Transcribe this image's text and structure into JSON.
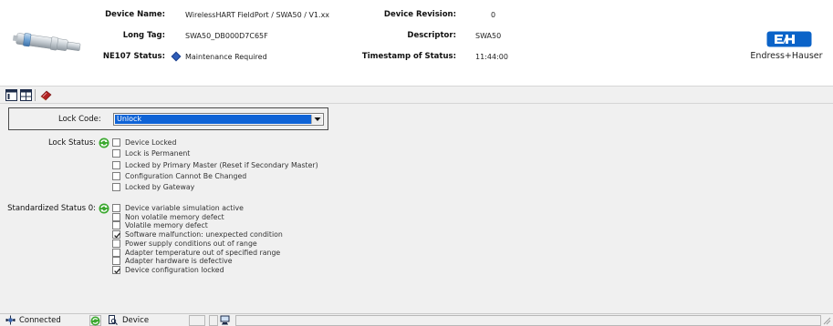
{
  "header": {
    "device_name_label": "Device Name:",
    "device_name_value": "WirelessHART FieldPort / SWA50 / V1.xx",
    "long_tag_label": "Long Tag:",
    "long_tag_value": "SWA50_DB000D7C65F",
    "ne107_label": "NE107 Status:",
    "ne107_value": "Maintenance Required",
    "device_revision_label": "Device Revision:",
    "device_revision_value": "0",
    "descriptor_label": "Descriptor:",
    "descriptor_value": "SWA50",
    "timestamp_label": "Timestamp of Status:",
    "timestamp_value": "11:44:00",
    "brand_name": "Endress+Hauser",
    "ne107_color": "#1a3f8f",
    "brand_color": "#0b63c8"
  },
  "toolbar": {
    "buttons": [
      "window-icon",
      "split-window-icon",
      "book-icon"
    ]
  },
  "lock_code": {
    "label": "Lock Code:",
    "value": "Unlock"
  },
  "lock_status": {
    "label": "Lock Status:",
    "items": [
      {
        "label": "Device Locked",
        "checked": false
      },
      {
        "label": "Lock is Permanent",
        "checked": false
      },
      {
        "label": "Locked by Primary Master (Reset if Secondary Master)",
        "checked": false
      },
      {
        "label": "Configuration Cannot Be Changed",
        "checked": false
      },
      {
        "label": "Locked by Gateway",
        "checked": false
      }
    ]
  },
  "standardized_status": {
    "label": "Standardized Status 0:",
    "items": [
      {
        "label": "Device variable simulation active",
        "checked": false
      },
      {
        "label": "Non volatile memory defect",
        "checked": false
      },
      {
        "label": "Volatile memory defect",
        "checked": false
      },
      {
        "label": "Software malfunction: unexpected condition",
        "checked": true
      },
      {
        "label": "Power supply conditions out of range",
        "checked": false
      },
      {
        "label": "Adapter temperature out of specified range",
        "checked": false
      },
      {
        "label": "Adapter hardware is defective",
        "checked": false
      },
      {
        "label": "Device configuration locked",
        "checked": true
      }
    ]
  },
  "statusbar": {
    "connection": "Connected",
    "device": "Device"
  },
  "colors": {
    "accent": "#0f63d6",
    "refresh_green": "#3aa82e"
  }
}
